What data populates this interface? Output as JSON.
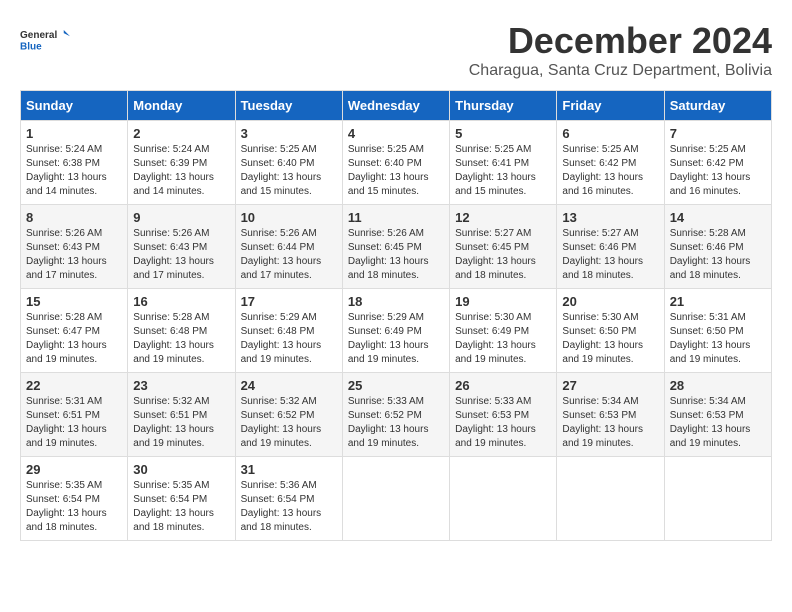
{
  "logo": {
    "line1": "General",
    "line2": "Blue"
  },
  "title": "December 2024",
  "subtitle": "Charagua, Santa Cruz Department, Bolivia",
  "days_of_week": [
    "Sunday",
    "Monday",
    "Tuesday",
    "Wednesday",
    "Thursday",
    "Friday",
    "Saturday"
  ],
  "weeks": [
    [
      {
        "day": "1",
        "info": "Sunrise: 5:24 AM\nSunset: 6:38 PM\nDaylight: 13 hours and 14 minutes."
      },
      {
        "day": "2",
        "info": "Sunrise: 5:24 AM\nSunset: 6:39 PM\nDaylight: 13 hours and 14 minutes."
      },
      {
        "day": "3",
        "info": "Sunrise: 5:25 AM\nSunset: 6:40 PM\nDaylight: 13 hours and 15 minutes."
      },
      {
        "day": "4",
        "info": "Sunrise: 5:25 AM\nSunset: 6:40 PM\nDaylight: 13 hours and 15 minutes."
      },
      {
        "day": "5",
        "info": "Sunrise: 5:25 AM\nSunset: 6:41 PM\nDaylight: 13 hours and 15 minutes."
      },
      {
        "day": "6",
        "info": "Sunrise: 5:25 AM\nSunset: 6:42 PM\nDaylight: 13 hours and 16 minutes."
      },
      {
        "day": "7",
        "info": "Sunrise: 5:25 AM\nSunset: 6:42 PM\nDaylight: 13 hours and 16 minutes."
      }
    ],
    [
      {
        "day": "8",
        "info": "Sunrise: 5:26 AM\nSunset: 6:43 PM\nDaylight: 13 hours and 17 minutes."
      },
      {
        "day": "9",
        "info": "Sunrise: 5:26 AM\nSunset: 6:43 PM\nDaylight: 13 hours and 17 minutes."
      },
      {
        "day": "10",
        "info": "Sunrise: 5:26 AM\nSunset: 6:44 PM\nDaylight: 13 hours and 17 minutes."
      },
      {
        "day": "11",
        "info": "Sunrise: 5:26 AM\nSunset: 6:45 PM\nDaylight: 13 hours and 18 minutes."
      },
      {
        "day": "12",
        "info": "Sunrise: 5:27 AM\nSunset: 6:45 PM\nDaylight: 13 hours and 18 minutes."
      },
      {
        "day": "13",
        "info": "Sunrise: 5:27 AM\nSunset: 6:46 PM\nDaylight: 13 hours and 18 minutes."
      },
      {
        "day": "14",
        "info": "Sunrise: 5:28 AM\nSunset: 6:46 PM\nDaylight: 13 hours and 18 minutes."
      }
    ],
    [
      {
        "day": "15",
        "info": "Sunrise: 5:28 AM\nSunset: 6:47 PM\nDaylight: 13 hours and 19 minutes."
      },
      {
        "day": "16",
        "info": "Sunrise: 5:28 AM\nSunset: 6:48 PM\nDaylight: 13 hours and 19 minutes."
      },
      {
        "day": "17",
        "info": "Sunrise: 5:29 AM\nSunset: 6:48 PM\nDaylight: 13 hours and 19 minutes."
      },
      {
        "day": "18",
        "info": "Sunrise: 5:29 AM\nSunset: 6:49 PM\nDaylight: 13 hours and 19 minutes."
      },
      {
        "day": "19",
        "info": "Sunrise: 5:30 AM\nSunset: 6:49 PM\nDaylight: 13 hours and 19 minutes."
      },
      {
        "day": "20",
        "info": "Sunrise: 5:30 AM\nSunset: 6:50 PM\nDaylight: 13 hours and 19 minutes."
      },
      {
        "day": "21",
        "info": "Sunrise: 5:31 AM\nSunset: 6:50 PM\nDaylight: 13 hours and 19 minutes."
      }
    ],
    [
      {
        "day": "22",
        "info": "Sunrise: 5:31 AM\nSunset: 6:51 PM\nDaylight: 13 hours and 19 minutes."
      },
      {
        "day": "23",
        "info": "Sunrise: 5:32 AM\nSunset: 6:51 PM\nDaylight: 13 hours and 19 minutes."
      },
      {
        "day": "24",
        "info": "Sunrise: 5:32 AM\nSunset: 6:52 PM\nDaylight: 13 hours and 19 minutes."
      },
      {
        "day": "25",
        "info": "Sunrise: 5:33 AM\nSunset: 6:52 PM\nDaylight: 13 hours and 19 minutes."
      },
      {
        "day": "26",
        "info": "Sunrise: 5:33 AM\nSunset: 6:53 PM\nDaylight: 13 hours and 19 minutes."
      },
      {
        "day": "27",
        "info": "Sunrise: 5:34 AM\nSunset: 6:53 PM\nDaylight: 13 hours and 19 minutes."
      },
      {
        "day": "28",
        "info": "Sunrise: 5:34 AM\nSunset: 6:53 PM\nDaylight: 13 hours and 19 minutes."
      }
    ],
    [
      {
        "day": "29",
        "info": "Sunrise: 5:35 AM\nSunset: 6:54 PM\nDaylight: 13 hours and 18 minutes."
      },
      {
        "day": "30",
        "info": "Sunrise: 5:35 AM\nSunset: 6:54 PM\nDaylight: 13 hours and 18 minutes."
      },
      {
        "day": "31",
        "info": "Sunrise: 5:36 AM\nSunset: 6:54 PM\nDaylight: 13 hours and 18 minutes."
      },
      {
        "day": "",
        "info": ""
      },
      {
        "day": "",
        "info": ""
      },
      {
        "day": "",
        "info": ""
      },
      {
        "day": "",
        "info": ""
      }
    ]
  ]
}
